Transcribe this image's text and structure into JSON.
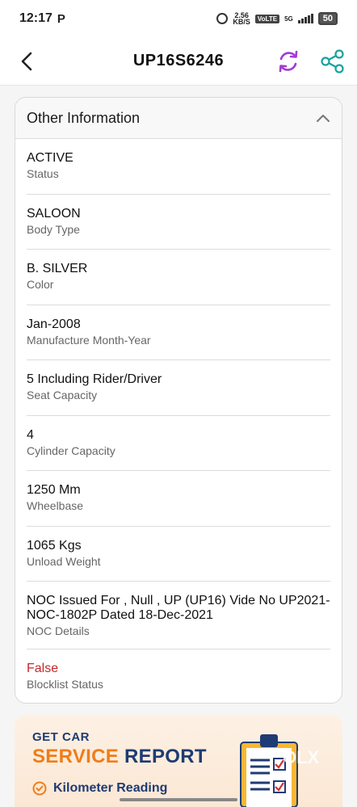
{
  "statusbar": {
    "time": "12:17",
    "carrier_icon": "P",
    "speed_top": "2.56",
    "speed_bottom": "KB/S",
    "volte": "VoLTE",
    "network": "5G",
    "battery": "50"
  },
  "header": {
    "title": "UP16S6246"
  },
  "card": {
    "heading": "Other Information",
    "rows": [
      {
        "value": "ACTIVE",
        "label": "Status"
      },
      {
        "value": "SALOON",
        "label": "Body Type"
      },
      {
        "value": "B. SILVER",
        "label": "Color"
      },
      {
        "value": "Jan-2008",
        "label": "Manufacture Month-Year"
      },
      {
        "value": "5 Including Rider/Driver",
        "label": "Seat Capacity"
      },
      {
        "value": "4",
        "label": "Cylinder Capacity"
      },
      {
        "value": "1250 Mm",
        "label": "Wheelbase"
      },
      {
        "value": "1065 Kgs",
        "label": "Unload Weight"
      },
      {
        "value": "NOC Issued For  , Null , UP (UP16) Vide No UP2021-NOC-1802P Dated 18-Dec-2021",
        "label": "NOC Details"
      },
      {
        "value": "False",
        "label": "Blocklist Status"
      }
    ]
  },
  "promo": {
    "get": "GET CAR",
    "big_orange": "SERVICE",
    "big_blue": "REPORT",
    "item": "Kilometer Reading",
    "watermark": "OLX"
  },
  "colors": {
    "accent_purple": "#a23bd6",
    "share_teal": "#17a3a0",
    "blocklist_red": "#c62828",
    "promo_orange": "#ef7d1a",
    "promo_blue": "#1f3b73"
  }
}
